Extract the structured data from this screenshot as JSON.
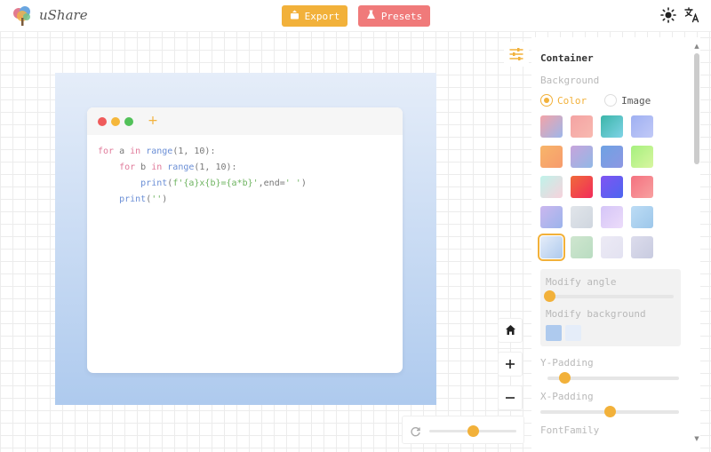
{
  "header": {
    "brand": "uShare",
    "export_label": "Export",
    "presets_label": "Presets"
  },
  "canvas": {
    "code_lines": [
      [
        {
          "t": "for ",
          "c": "kw"
        },
        {
          "t": "a ",
          "c": "plain"
        },
        {
          "t": "in ",
          "c": "kw"
        },
        {
          "t": "range",
          "c": "fn"
        },
        {
          "t": "(1, 10):",
          "c": "plain"
        }
      ],
      [
        {
          "t": "    for ",
          "c": "kw"
        },
        {
          "t": "b ",
          "c": "plain"
        },
        {
          "t": "in ",
          "c": "kw"
        },
        {
          "t": "range",
          "c": "fn"
        },
        {
          "t": "(1, 10):",
          "c": "plain"
        }
      ],
      [
        {
          "t": "        print",
          "c": "fn"
        },
        {
          "t": "(",
          "c": "plain"
        },
        {
          "t": "f'{a}x{b}={a*b}'",
          "c": "str"
        },
        {
          "t": ",end=",
          "c": "plain"
        },
        {
          "t": "' '",
          "c": "str"
        },
        {
          "t": ")",
          "c": "plain"
        }
      ],
      [
        {
          "t": "    print",
          "c": "fn"
        },
        {
          "t": "(",
          "c": "plain"
        },
        {
          "t": "''",
          "c": "str"
        },
        {
          "t": ")",
          "c": "plain"
        }
      ]
    ],
    "zoom_level": 0.5
  },
  "panel": {
    "title": "Container",
    "background_label": "Background",
    "color_option": "Color",
    "image_option": "Image",
    "selected_option": "Color",
    "swatches": [
      {
        "from": "#f3a3a8",
        "to": "#9db6ea"
      },
      {
        "from": "#f4a3a3",
        "to": "#f8b9b0"
      },
      {
        "from": "#3bb5a9",
        "to": "#7fd3e6"
      },
      {
        "from": "#9fb0f2",
        "to": "#c1c9f7"
      },
      {
        "from": "#f7b56a",
        "to": "#f79b6d"
      },
      {
        "from": "#c7a4dc",
        "to": "#91b8e6"
      },
      {
        "from": "#6ea2e3",
        "to": "#8d97e3"
      },
      {
        "from": "#a6f07e",
        "to": "#d8f6a0"
      },
      {
        "from": "#bff3ea",
        "to": "#f7d2dc"
      },
      {
        "from": "#f06a3a",
        "to": "#f22b5a"
      },
      {
        "from": "#8054f2",
        "to": "#4c66f0"
      },
      {
        "from": "#f47280",
        "to": "#f8a0a0"
      },
      {
        "from": "#cbb7ee",
        "to": "#9bb4ec"
      },
      {
        "from": "#e1e5ea",
        "to": "#cfd6df"
      },
      {
        "from": "#d5c5f7",
        "to": "#ecdcfa"
      },
      {
        "from": "#bcdcf5",
        "to": "#9dc7ea"
      },
      {
        "from": "#e5edf9",
        "to": "#aecaee"
      },
      {
        "from": "#cfe6cf",
        "to": "#b9dcc1"
      },
      {
        "from": "#eceaf5",
        "to": "#e3e2f1"
      },
      {
        "from": "#dcdcec",
        "to": "#c8cbe0"
      }
    ],
    "selected_swatch": 16,
    "modify_angle_label": "Modify angle",
    "modify_angle_value": 0.0,
    "modify_background_label": "Modify background",
    "modify_colors": [
      "#aecaee",
      "#e5edf9"
    ],
    "y_padding_label": "Y-Padding",
    "y_padding_value": 0.13,
    "x_padding_label": "X-Padding",
    "x_padding_value": 0.5,
    "font_family_label": "FontFamily"
  },
  "colors": {
    "accent": "#f2b13a",
    "presets": "#f07a7a"
  },
  "icons": [
    "tree-logo-icon",
    "export-icon",
    "presets-flask-icon",
    "sun-icon",
    "translate-icon",
    "settings-sliders-icon",
    "home-icon",
    "zoom-in-icon",
    "zoom-out-icon",
    "reset-icon"
  ]
}
